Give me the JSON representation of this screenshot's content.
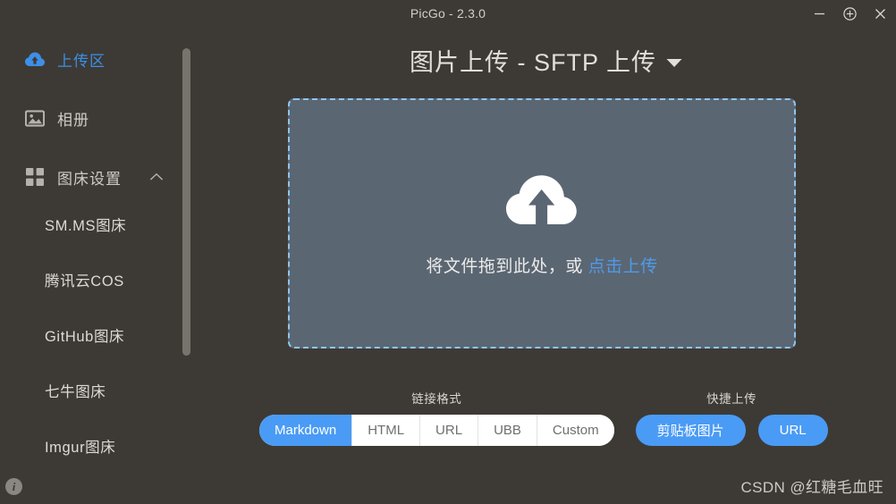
{
  "window": {
    "title": "PicGo - 2.3.0",
    "controls": [
      {
        "name": "minimize",
        "glyph": "minimize-icon"
      },
      {
        "name": "maximize",
        "glyph": "circle-plus-icon"
      },
      {
        "name": "close",
        "glyph": "close-icon"
      }
    ]
  },
  "sidebar": {
    "items": [
      {
        "label": "上传区",
        "icon": "cloud-upload-icon",
        "active": true
      },
      {
        "label": "相册",
        "icon": "image-icon",
        "active": false
      },
      {
        "label": "图床设置",
        "icon": "grid-icon",
        "active": false,
        "expanded": true
      }
    ],
    "sub_items": [
      {
        "label": "SM.MS图床"
      },
      {
        "label": "腾讯云COS"
      },
      {
        "label": "GitHub图床"
      },
      {
        "label": "七牛图床"
      },
      {
        "label": "Imgur图床"
      }
    ],
    "info_glyph": "i"
  },
  "main": {
    "page_title": "图片上传 - SFTP 上传",
    "title_caret": "▼",
    "dropzone": {
      "icon": "cloud-upload-icon",
      "text_prefix": "将文件拖到此处，或 ",
      "link_text": "点击上传"
    },
    "link_format": {
      "label": "链接格式",
      "options": [
        {
          "label": "Markdown",
          "active": true
        },
        {
          "label": "HTML",
          "active": false
        },
        {
          "label": "URL",
          "active": false
        },
        {
          "label": "UBB",
          "active": false
        },
        {
          "label": "Custom",
          "active": false
        }
      ]
    },
    "quick_upload": {
      "label": "快捷上传",
      "buttons": [
        {
          "label": "剪贴板图片"
        },
        {
          "label": "URL"
        }
      ]
    }
  },
  "watermark": "CSDN @红糖毛血旺",
  "colors": {
    "app_bg": "#3d3a35",
    "accent": "#4a9bf5",
    "dropzone_bg": "#5b6673",
    "dropzone_border": "#8ec5ef",
    "text": "#d2cfca"
  }
}
